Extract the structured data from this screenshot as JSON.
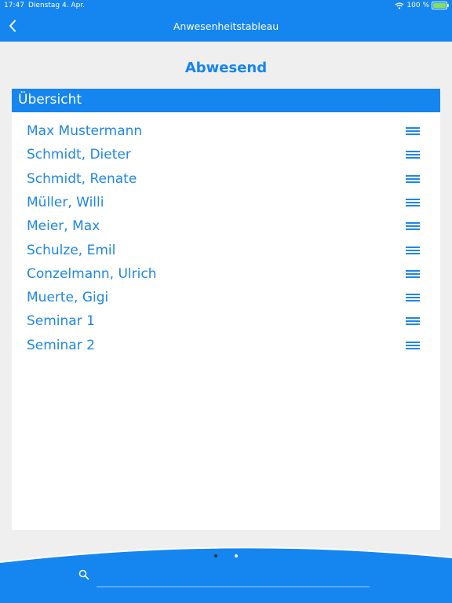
{
  "status_bar": {
    "time": "17:47",
    "date": "Dienstag 4. Apr.",
    "battery_text": "100 %",
    "battery_level": 1.0
  },
  "nav": {
    "title": "Anwesenheitstableau",
    "back_icon": "chevron-left-icon"
  },
  "heading": "Abwesend",
  "panel": {
    "header": "Übersicht",
    "items": [
      {
        "label": "Max Mustermann"
      },
      {
        "label": "Schmidt, Dieter"
      },
      {
        "label": "Schmidt, Renate"
      },
      {
        "label": "Müller, Willi"
      },
      {
        "label": "Meier, Max"
      },
      {
        "label": "Schulze, Emil"
      },
      {
        "label": "Conzelmann, Ulrich"
      },
      {
        "label": "Muerte, Gigi"
      },
      {
        "label": "Seminar 1"
      },
      {
        "label": "Seminar 2"
      }
    ],
    "handle_icon": "drag-handle-icon"
  },
  "pager": {
    "pages": 2,
    "current": 1
  },
  "search": {
    "icon": "search-icon",
    "placeholder": ""
  },
  "colors": {
    "primary": "#1585f0",
    "text_blue": "#1f86e8",
    "background": "#efeff0"
  }
}
